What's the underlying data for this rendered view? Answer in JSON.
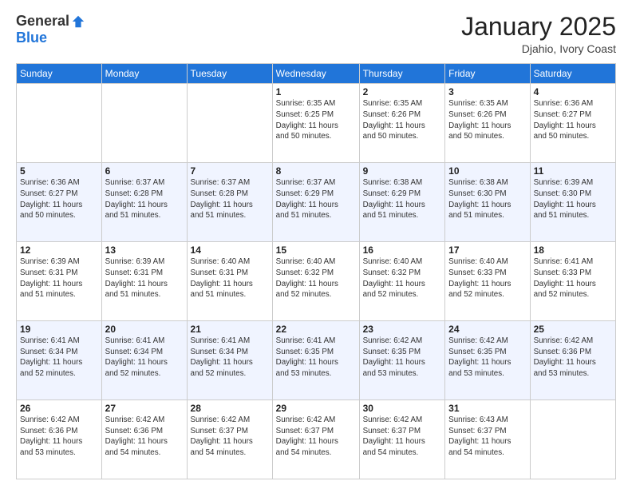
{
  "logo": {
    "general": "General",
    "blue": "Blue"
  },
  "header": {
    "month": "January 2025",
    "location": "Djahio, Ivory Coast"
  },
  "weekdays": [
    "Sunday",
    "Monday",
    "Tuesday",
    "Wednesday",
    "Thursday",
    "Friday",
    "Saturday"
  ],
  "weeks": [
    [
      {
        "day": "",
        "info": ""
      },
      {
        "day": "",
        "info": ""
      },
      {
        "day": "",
        "info": ""
      },
      {
        "day": "1",
        "info": "Sunrise: 6:35 AM\nSunset: 6:25 PM\nDaylight: 11 hours\nand 50 minutes."
      },
      {
        "day": "2",
        "info": "Sunrise: 6:35 AM\nSunset: 6:26 PM\nDaylight: 11 hours\nand 50 minutes."
      },
      {
        "day": "3",
        "info": "Sunrise: 6:35 AM\nSunset: 6:26 PM\nDaylight: 11 hours\nand 50 minutes."
      },
      {
        "day": "4",
        "info": "Sunrise: 6:36 AM\nSunset: 6:27 PM\nDaylight: 11 hours\nand 50 minutes."
      }
    ],
    [
      {
        "day": "5",
        "info": "Sunrise: 6:36 AM\nSunset: 6:27 PM\nDaylight: 11 hours\nand 50 minutes."
      },
      {
        "day": "6",
        "info": "Sunrise: 6:37 AM\nSunset: 6:28 PM\nDaylight: 11 hours\nand 51 minutes."
      },
      {
        "day": "7",
        "info": "Sunrise: 6:37 AM\nSunset: 6:28 PM\nDaylight: 11 hours\nand 51 minutes."
      },
      {
        "day": "8",
        "info": "Sunrise: 6:37 AM\nSunset: 6:29 PM\nDaylight: 11 hours\nand 51 minutes."
      },
      {
        "day": "9",
        "info": "Sunrise: 6:38 AM\nSunset: 6:29 PM\nDaylight: 11 hours\nand 51 minutes."
      },
      {
        "day": "10",
        "info": "Sunrise: 6:38 AM\nSunset: 6:30 PM\nDaylight: 11 hours\nand 51 minutes."
      },
      {
        "day": "11",
        "info": "Sunrise: 6:39 AM\nSunset: 6:30 PM\nDaylight: 11 hours\nand 51 minutes."
      }
    ],
    [
      {
        "day": "12",
        "info": "Sunrise: 6:39 AM\nSunset: 6:31 PM\nDaylight: 11 hours\nand 51 minutes."
      },
      {
        "day": "13",
        "info": "Sunrise: 6:39 AM\nSunset: 6:31 PM\nDaylight: 11 hours\nand 51 minutes."
      },
      {
        "day": "14",
        "info": "Sunrise: 6:40 AM\nSunset: 6:31 PM\nDaylight: 11 hours\nand 51 minutes."
      },
      {
        "day": "15",
        "info": "Sunrise: 6:40 AM\nSunset: 6:32 PM\nDaylight: 11 hours\nand 52 minutes."
      },
      {
        "day": "16",
        "info": "Sunrise: 6:40 AM\nSunset: 6:32 PM\nDaylight: 11 hours\nand 52 minutes."
      },
      {
        "day": "17",
        "info": "Sunrise: 6:40 AM\nSunset: 6:33 PM\nDaylight: 11 hours\nand 52 minutes."
      },
      {
        "day": "18",
        "info": "Sunrise: 6:41 AM\nSunset: 6:33 PM\nDaylight: 11 hours\nand 52 minutes."
      }
    ],
    [
      {
        "day": "19",
        "info": "Sunrise: 6:41 AM\nSunset: 6:34 PM\nDaylight: 11 hours\nand 52 minutes."
      },
      {
        "day": "20",
        "info": "Sunrise: 6:41 AM\nSunset: 6:34 PM\nDaylight: 11 hours\nand 52 minutes."
      },
      {
        "day": "21",
        "info": "Sunrise: 6:41 AM\nSunset: 6:34 PM\nDaylight: 11 hours\nand 52 minutes."
      },
      {
        "day": "22",
        "info": "Sunrise: 6:41 AM\nSunset: 6:35 PM\nDaylight: 11 hours\nand 53 minutes."
      },
      {
        "day": "23",
        "info": "Sunrise: 6:42 AM\nSunset: 6:35 PM\nDaylight: 11 hours\nand 53 minutes."
      },
      {
        "day": "24",
        "info": "Sunrise: 6:42 AM\nSunset: 6:35 PM\nDaylight: 11 hours\nand 53 minutes."
      },
      {
        "day": "25",
        "info": "Sunrise: 6:42 AM\nSunset: 6:36 PM\nDaylight: 11 hours\nand 53 minutes."
      }
    ],
    [
      {
        "day": "26",
        "info": "Sunrise: 6:42 AM\nSunset: 6:36 PM\nDaylight: 11 hours\nand 53 minutes."
      },
      {
        "day": "27",
        "info": "Sunrise: 6:42 AM\nSunset: 6:36 PM\nDaylight: 11 hours\nand 54 minutes."
      },
      {
        "day": "28",
        "info": "Sunrise: 6:42 AM\nSunset: 6:37 PM\nDaylight: 11 hours\nand 54 minutes."
      },
      {
        "day": "29",
        "info": "Sunrise: 6:42 AM\nSunset: 6:37 PM\nDaylight: 11 hours\nand 54 minutes."
      },
      {
        "day": "30",
        "info": "Sunrise: 6:42 AM\nSunset: 6:37 PM\nDaylight: 11 hours\nand 54 minutes."
      },
      {
        "day": "31",
        "info": "Sunrise: 6:43 AM\nSunset: 6:37 PM\nDaylight: 11 hours\nand 54 minutes."
      },
      {
        "day": "",
        "info": ""
      }
    ]
  ]
}
